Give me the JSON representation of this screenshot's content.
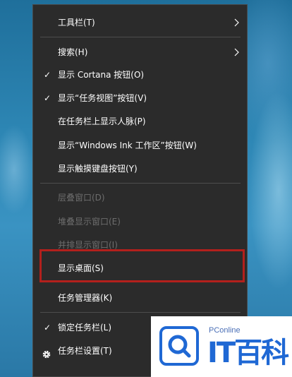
{
  "context_menu": {
    "items": [
      {
        "label": "工具栏(T)",
        "checked": false,
        "submenu": true,
        "disabled": false
      },
      {
        "label": "搜索(H)",
        "checked": false,
        "submenu": true,
        "disabled": false
      },
      {
        "label": "显示 Cortana 按钮(O)",
        "checked": true,
        "submenu": false,
        "disabled": false
      },
      {
        "label": "显示“任务视图”按钮(V)",
        "checked": true,
        "submenu": false,
        "disabled": false
      },
      {
        "label": "在任务栏上显示人脉(P)",
        "checked": false,
        "submenu": false,
        "disabled": false
      },
      {
        "label": "显示“Windows Ink 工作区”按钮(W)",
        "checked": false,
        "submenu": false,
        "disabled": false
      },
      {
        "label": "显示触摸键盘按钮(Y)",
        "checked": false,
        "submenu": false,
        "disabled": false
      },
      {
        "label": "层叠窗口(D)",
        "checked": false,
        "submenu": false,
        "disabled": true
      },
      {
        "label": "堆叠显示窗口(E)",
        "checked": false,
        "submenu": false,
        "disabled": true
      },
      {
        "label": "并排显示窗口(I)",
        "checked": false,
        "submenu": false,
        "disabled": true
      },
      {
        "label": "显示桌面(S)",
        "checked": false,
        "submenu": false,
        "disabled": false,
        "highlighted": true
      },
      {
        "label": "任务管理器(K)",
        "checked": false,
        "submenu": false,
        "disabled": false
      },
      {
        "label": "锁定任务栏(L)",
        "checked": true,
        "submenu": false,
        "disabled": false
      },
      {
        "label": "任务栏设置(T)",
        "checked": false,
        "submenu": false,
        "disabled": false,
        "icon": "gear-icon"
      }
    ],
    "check_glyph": "✓",
    "highlight_color": "#b3201c"
  },
  "watermark": {
    "small_text": "PConline",
    "big_text": "IT百科",
    "accent_color": "#1f68d4"
  }
}
